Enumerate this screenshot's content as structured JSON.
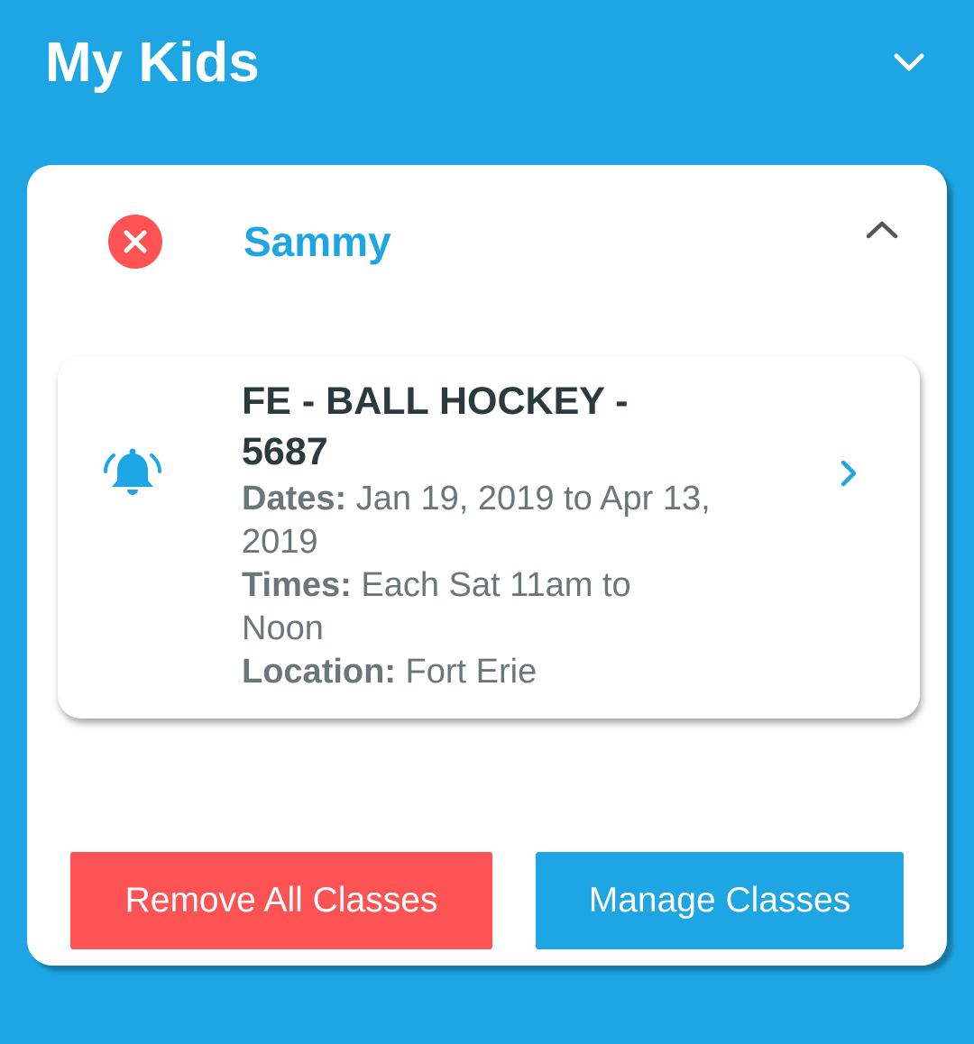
{
  "header": {
    "title": "My Kids"
  },
  "kid": {
    "name": "Sammy"
  },
  "class_item": {
    "title": "FE - BALL HOCKEY - 5687",
    "dates_label": "Dates:",
    "dates_value": "Jan 19, 2019 to Apr 13, 2019",
    "times_label": "Times:",
    "times_value": "Each Sat 11am to Noon",
    "location_label": "Location:",
    "location_value": "Fort Erie"
  },
  "buttons": {
    "remove_all": "Remove All Classes",
    "manage": "Manage Classes"
  },
  "icons": {
    "header_toggle": "chevron-down-icon",
    "remove_kid": "close-circle-icon",
    "collapse": "chevron-up-icon",
    "notification": "bell-ringing-icon",
    "open_class": "chevron-right-icon"
  },
  "colors": {
    "background": "#1ea5e3",
    "accent": "#1ea5e3",
    "danger": "#fd5354",
    "card": "#ffffff",
    "title_text": "#2b3a3f",
    "detail_text": "#6b7678"
  }
}
